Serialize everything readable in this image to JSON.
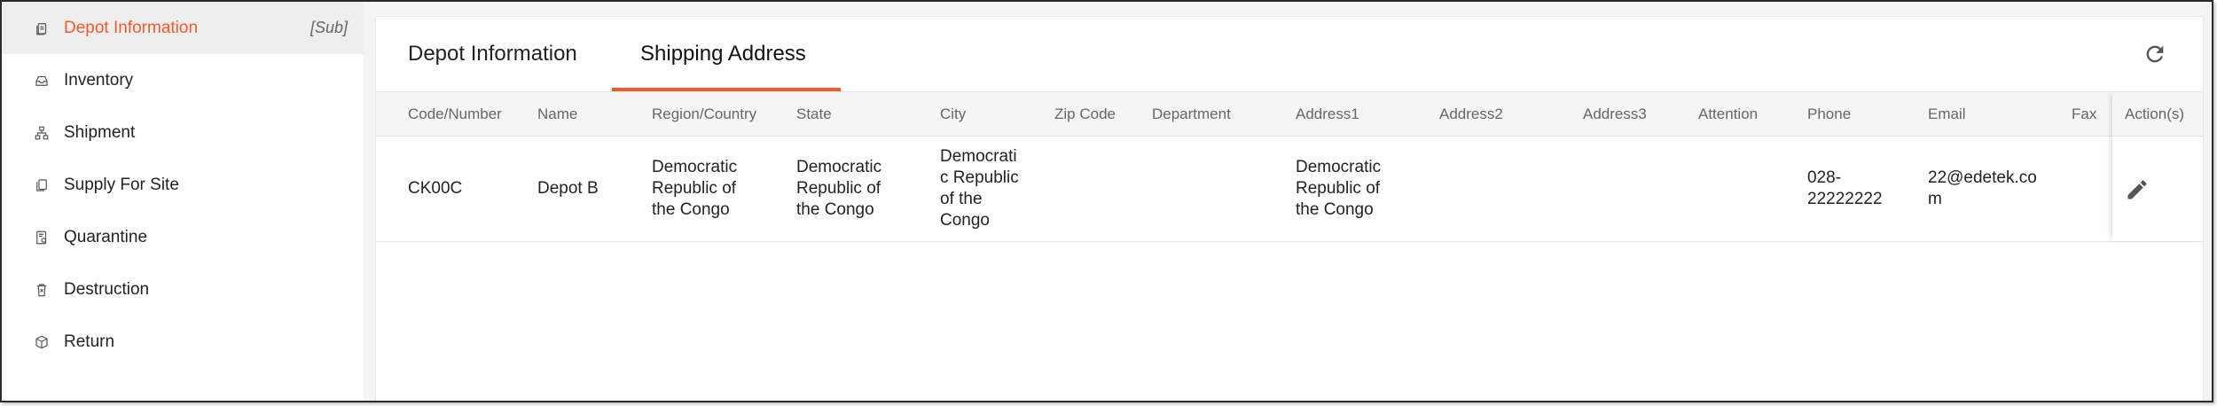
{
  "sidebar": {
    "items": [
      {
        "label": "Depot Information",
        "icon": "document-icon",
        "active": true,
        "tag": "[Sub]"
      },
      {
        "label": "Inventory",
        "icon": "inbox-icon"
      },
      {
        "label": "Shipment",
        "icon": "hierarchy-icon"
      },
      {
        "label": "Supply For Site",
        "icon": "copy-icon"
      },
      {
        "label": "Quarantine",
        "icon": "quarantine-icon"
      },
      {
        "label": "Destruction",
        "icon": "trash-icon"
      },
      {
        "label": "Return",
        "icon": "box-icon"
      }
    ]
  },
  "tabs": [
    {
      "label": "Depot Information"
    },
    {
      "label": "Shipping Address",
      "selected": true
    }
  ],
  "table": {
    "headers": [
      "Code/Number",
      "Name",
      "Region/Country",
      "State",
      "City",
      "Zip Code",
      "Department",
      "Address1",
      "Address2",
      "Address3",
      "Attention",
      "Phone",
      "Email",
      "Fax",
      "Action(s)"
    ],
    "rows": [
      {
        "code": "CK00C",
        "name": "Depot B",
        "region": "Democratic\nRepublic of\nthe Congo",
        "state": "Democratic\nRepublic of\nthe Congo",
        "city": "Democrati\nc Republic\nof the\nCongo",
        "zip": "",
        "department": "",
        "address1": "Democratic\nRepublic of\nthe Congo",
        "address2": "",
        "address3": "",
        "attention": "",
        "phone": "028-\n22222222",
        "email": "22@edetek.co\nm",
        "fax": ""
      }
    ]
  },
  "colors": {
    "accent": "#f05a28",
    "text": "#222222",
    "header_text": "#666666"
  }
}
